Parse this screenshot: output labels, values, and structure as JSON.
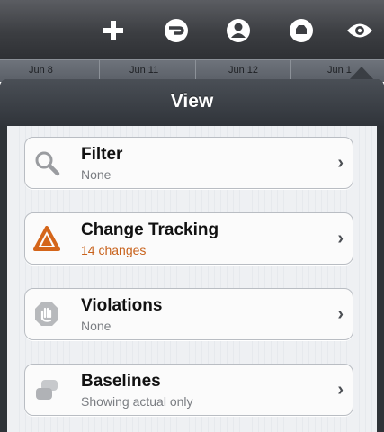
{
  "toolbar": {
    "buttons": [
      {
        "name": "add-icon"
      },
      {
        "name": "minus-circle-icon"
      },
      {
        "name": "person-icon"
      },
      {
        "name": "stop-icon"
      },
      {
        "name": "eye-icon"
      }
    ]
  },
  "timeline": {
    "dates": [
      "Jun 8",
      "Jun 11",
      "Jun 12",
      "Jun 1"
    ]
  },
  "popover": {
    "title": "View",
    "items": [
      {
        "title": "Filter",
        "subtitle": "None",
        "icon": "magnifier-icon"
      },
      {
        "title": "Change Tracking",
        "subtitle": "14 changes",
        "icon": "warning-triangle-icon",
        "subtitle_color": "#c8621c"
      },
      {
        "title": "Violations",
        "subtitle": "None",
        "icon": "hand-stop-icon"
      },
      {
        "title": "Baselines",
        "subtitle": "Showing actual only",
        "icon": "baselines-icon"
      }
    ],
    "chevron": "›"
  }
}
